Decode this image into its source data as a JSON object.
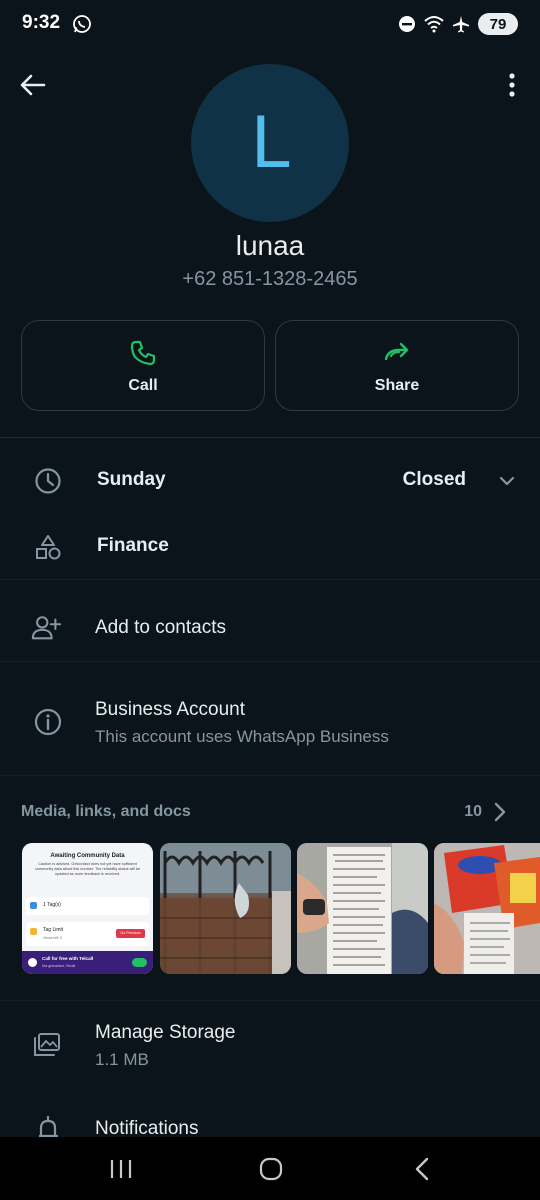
{
  "status_bar": {
    "time": "9:32",
    "battery": "79"
  },
  "profile": {
    "avatar_initial": "L",
    "name": "lunaa",
    "phone": "+62 851-1328-2465"
  },
  "actions": {
    "call_label": "Call",
    "share_label": "Share"
  },
  "hours": {
    "day": "Sunday",
    "status": "Closed"
  },
  "category": {
    "label": "Finance"
  },
  "add_contact": {
    "label": "Add to contacts"
  },
  "business": {
    "title": "Business Account",
    "subtitle": "This account uses WhatsApp Business"
  },
  "media": {
    "title": "Media, links, and docs",
    "count": "10",
    "thumb1": {
      "heading": "Awaiting Community Data",
      "body": "Caution is advised. Getcontact does not yet have sufficient community data about this number. The reliability status will be updated as more feedback is received.",
      "tag_label": "1 Tag(s)",
      "limit_label": "Tag Limit",
      "limit_sub": "Views left: 0",
      "limit_btn": "Go Premium",
      "footer_title": "Call for free with Telcall",
      "footer_sub": "Not getcontact, Telcall"
    }
  },
  "storage": {
    "title": "Manage Storage",
    "size": "1.1 MB"
  },
  "notifications": {
    "label": "Notifications"
  },
  "colors": {
    "background": "#0b141a",
    "accent_green": "#21c063",
    "avatar_bg": "#103247",
    "avatar_text": "#53bdeb",
    "secondary_text": "#8696a0"
  }
}
